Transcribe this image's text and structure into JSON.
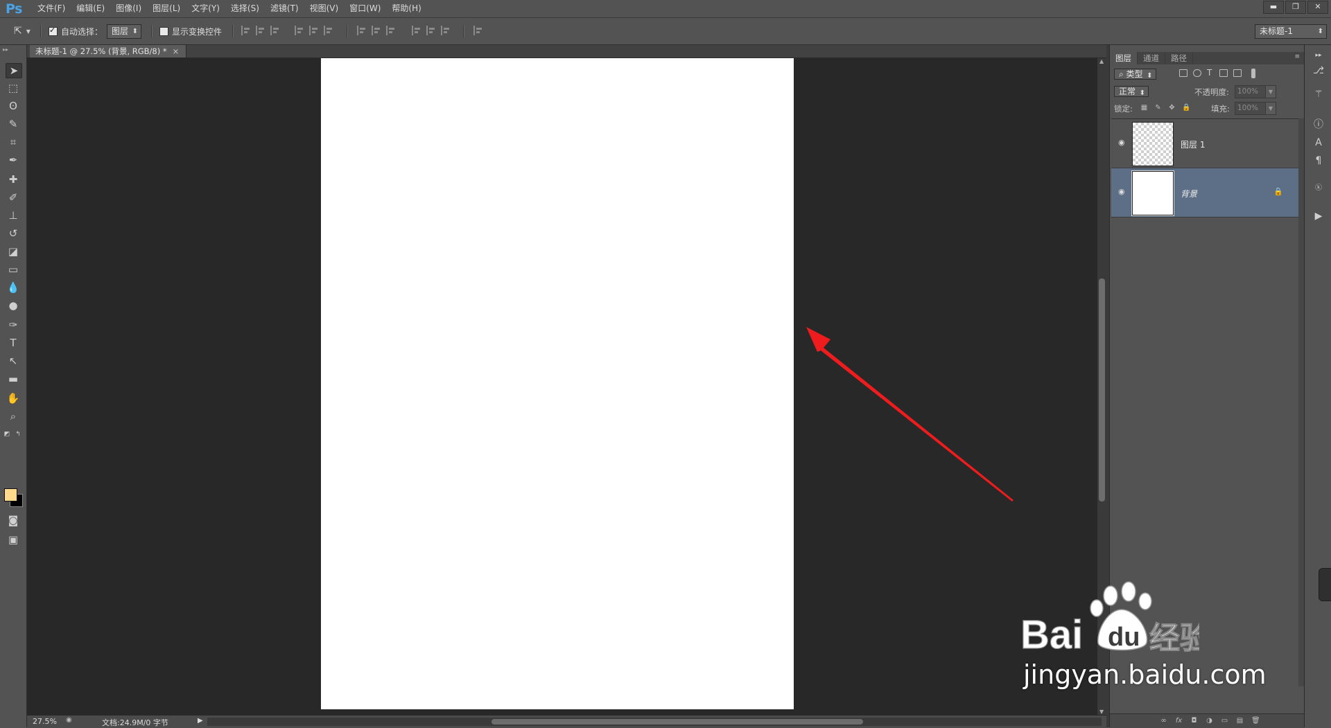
{
  "app": {
    "logo": "Ps",
    "menu": [
      "文件(F)",
      "编辑(E)",
      "图像(I)",
      "图层(L)",
      "文字(Y)",
      "选择(S)",
      "滤镜(T)",
      "视图(V)",
      "窗口(W)",
      "帮助(H)"
    ],
    "window_controls": [
      "minimize-icon",
      "restore-icon",
      "close-icon"
    ]
  },
  "options": {
    "auto_select_label": "自动选择：",
    "auto_select_checked": true,
    "auto_select_value": "图层",
    "show_transform_label": "显示变换控件",
    "show_transform_checked": false,
    "workspace_value": "未标题-1"
  },
  "document": {
    "tab_title": "未标题-1 @ 27.5% (背景, RGB/8) *",
    "tab_close": "×",
    "zoom": "27.5%",
    "info": "文档:24.9M/0 字节"
  },
  "colors": {
    "foreground": "#ffd98c",
    "background": "#000000",
    "arrow": "#ee1c1c",
    "selected_layer": "#5d6e87"
  },
  "layers_panel": {
    "tabs": [
      "图层",
      "通道",
      "路径"
    ],
    "filter_value": "类型",
    "blend_mode": "正常",
    "opacity_label": "不透明度:",
    "opacity_value": "100%",
    "lock_label": "锁定:",
    "fill_label": "填充:",
    "fill_value": "100%",
    "layers": [
      {
        "name": "图层 1",
        "visible": true,
        "selected": false,
        "locked": false,
        "thumbnail": "transparent"
      },
      {
        "name": "背景",
        "visible": true,
        "selected": true,
        "locked": true,
        "thumbnail": "white"
      }
    ]
  },
  "watermark": {
    "brand": "Bai 经验",
    "url": "jingyan.baidu.com"
  }
}
